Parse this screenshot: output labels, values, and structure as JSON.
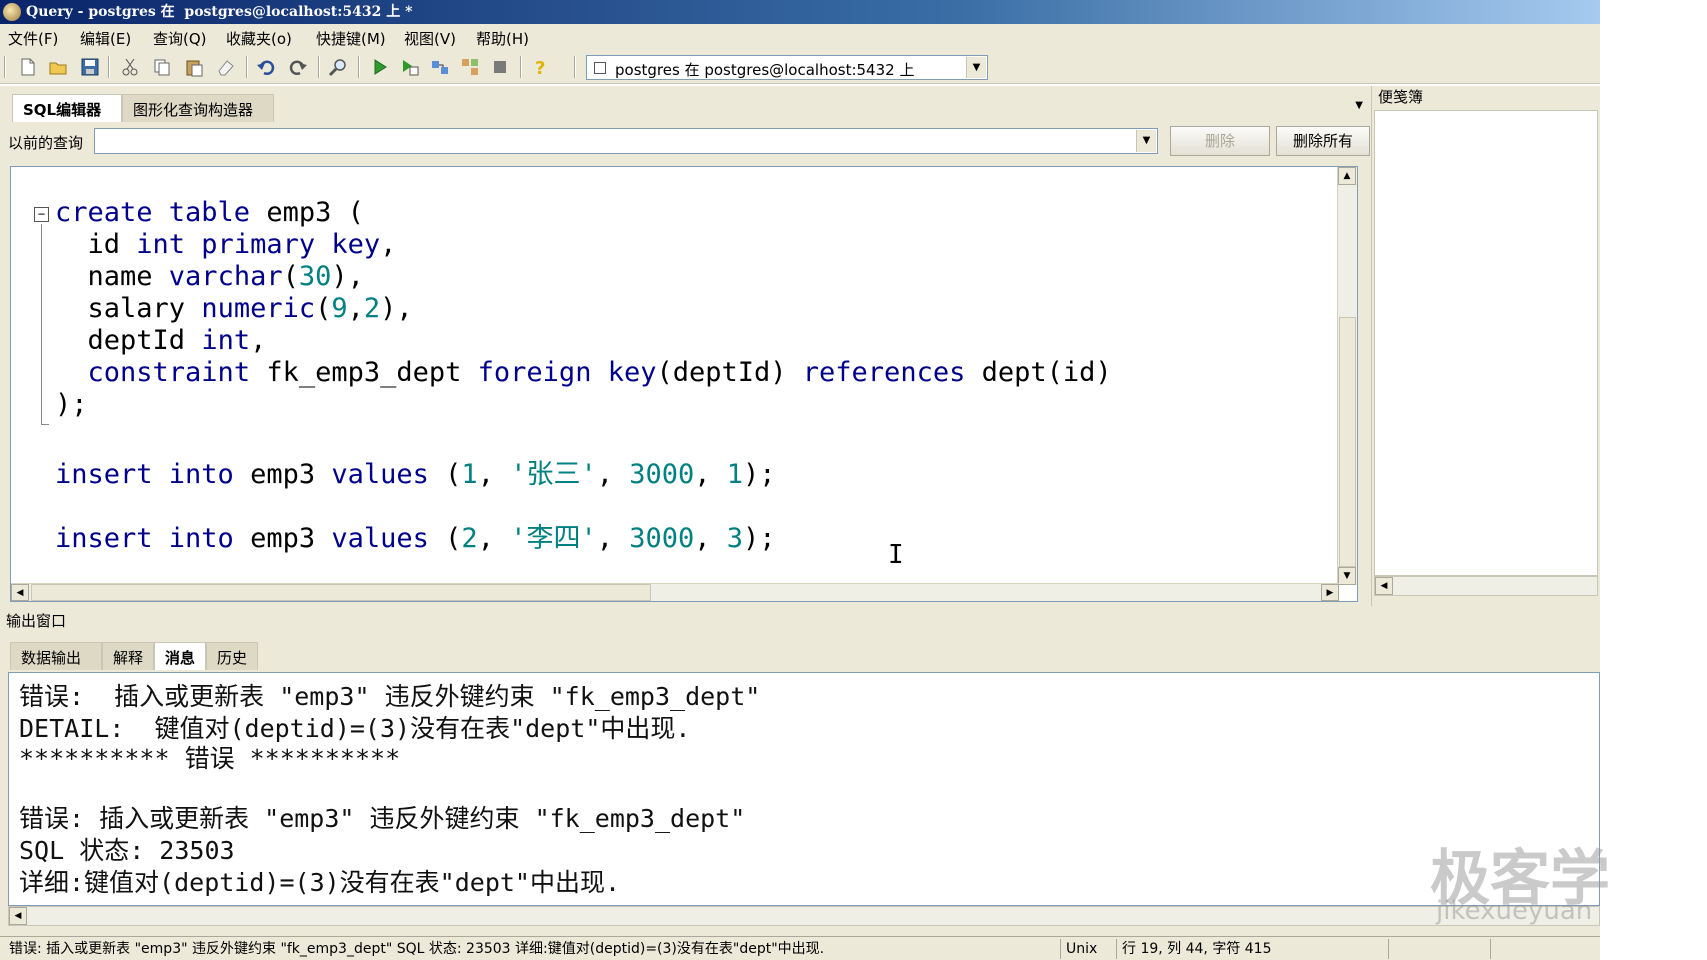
{
  "window": {
    "title": "Query - postgres 在  postgres@localhost:5432 上 *"
  },
  "menu": [
    "文件(F)",
    "编辑(E)",
    "查询(Q)",
    "收藏夹(o)",
    "快捷键(M)",
    "视图(V)",
    "帮助(H)"
  ],
  "toolbar": {
    "icons": [
      "new-file-icon",
      "open-folder-icon",
      "save-icon",
      "cut-icon",
      "copy-icon",
      "paste-icon",
      "eraser-icon",
      "undo-icon",
      "redo-icon",
      "find-icon",
      "execute-icon",
      "execute-to-file-icon",
      "explain-icon",
      "explain-analyze-icon",
      "stop-icon",
      "help-icon"
    ],
    "connection": "postgres 在  postgres@localhost:5432 上"
  },
  "editor": {
    "tabs": [
      "SQL编辑器",
      "图形化查询构造器"
    ],
    "active_tab": "SQL编辑器",
    "previous_query_label": "以前的查询",
    "delete_button": "删除",
    "delete_all_button": "删除所有"
  },
  "code": {
    "l1a": "create table",
    "l1b": " emp3 (",
    "l2a": "  id ",
    "l2b": "int primary key",
    "l2c": ",",
    "l3a": "  name ",
    "l3b": "varchar",
    "l3c": "(",
    "l3d": "30",
    "l3e": "),",
    "l4a": "  salary ",
    "l4b": "numeric",
    "l4c": "(",
    "l4d": "9",
    "l4e": ",",
    "l4f": "2",
    "l4g": "),",
    "l5a": "  deptId ",
    "l5b": "int",
    "l5c": ",",
    "l6a": "  ",
    "l6b": "constraint",
    "l6c": " fk_emp3_dept ",
    "l6d": "foreign key",
    "l6e": "(deptId) ",
    "l6f": "references",
    "l6g": " dept(id)",
    "l7a": ");",
    "ins1a": "insert into",
    "ins1b": " emp3 ",
    "ins1c": "values",
    "ins1d": " (",
    "ins1e": "1",
    "ins1f": ", ",
    "ins1g": "'张三'",
    "ins1h": ", ",
    "ins1i": "3000",
    "ins1j": ", ",
    "ins1k": "1",
    "ins1l": ");",
    "ins2a": "insert into",
    "ins2b": " emp3 ",
    "ins2c": "values",
    "ins2d": " (",
    "ins2e": "2",
    "ins2f": ", ",
    "ins2g": "'李四'",
    "ins2h": ", ",
    "ins2i": "3000",
    "ins2j": ", ",
    "ins2k": "3",
    "ins2l": ");"
  },
  "scratch_pad": {
    "title": "便笺簿"
  },
  "output": {
    "title": "输出窗口",
    "tabs": [
      "数据输出",
      "解释",
      "消息",
      "历史"
    ],
    "active_tab": "消息",
    "messages": [
      "错误:  插入或更新表 \"emp3\" 违反外键约束 \"fk_emp3_dept\"",
      "DETAIL:  键值对(deptid)=(3)没有在表\"dept\"中出现.",
      "********** 错误 **********",
      "",
      "错误: 插入或更新表 \"emp3\" 违反外键约束 \"fk_emp3_dept\"",
      "SQL 状态: 23503",
      "详细:键值对(deptid)=(3)没有在表\"dept\"中出现."
    ]
  },
  "status": {
    "message": "错误: 插入或更新表 \"emp3\" 违反外键约束 \"fk_emp3_dept\" SQL 状态: 23503 详细:键值对(deptid)=(3)没有在表\"dept\"中出现.",
    "line_ending": "Unix",
    "position": "行 19, 列 44, 字符 415"
  },
  "watermark": {
    "main": "极客学",
    "sub": "jikexueyuan"
  },
  "colors": {
    "keyword": "#00008b",
    "number": "#008080",
    "chrome": "#ece9d8"
  }
}
